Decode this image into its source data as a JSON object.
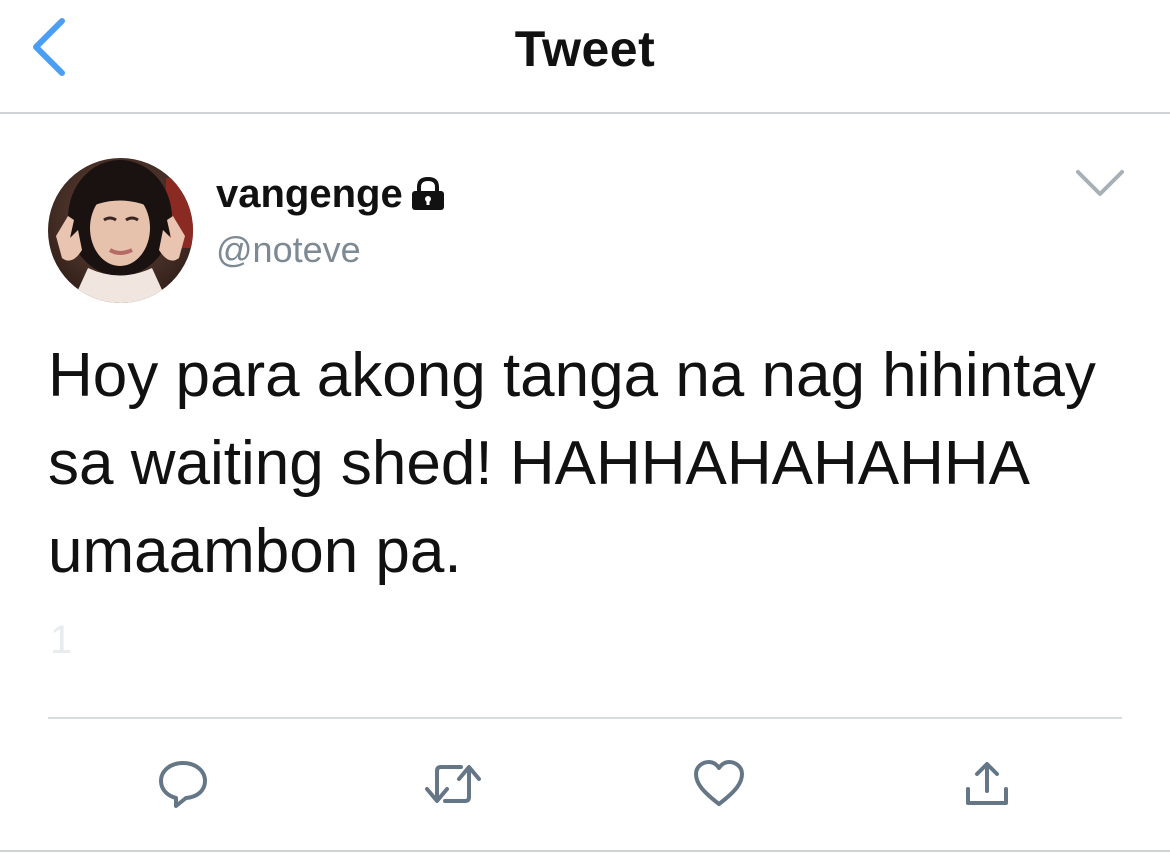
{
  "header": {
    "title": "Tweet",
    "back_icon": "chevron-left-icon"
  },
  "tweet": {
    "display_name": "vangenge",
    "protected_icon": "lock-icon",
    "handle": "@noteve",
    "text": "Hoy para akong tanga na nag hihintay sa waiting shed! HAHHAHAHAHHA umaambon pa.",
    "faded_stat": "1",
    "menu_icon": "chevron-down-icon"
  },
  "actions": [
    {
      "name": "reply",
      "icon": "reply-icon"
    },
    {
      "name": "retweet",
      "icon": "retweet-icon"
    },
    {
      "name": "like",
      "icon": "heart-icon"
    },
    {
      "name": "share",
      "icon": "share-icon"
    }
  ],
  "colors": {
    "accent": "#1da1f2",
    "icon_gray": "#657786",
    "divider": "#cfd3d6",
    "text": "#111111",
    "handle": "#7e8a93"
  }
}
